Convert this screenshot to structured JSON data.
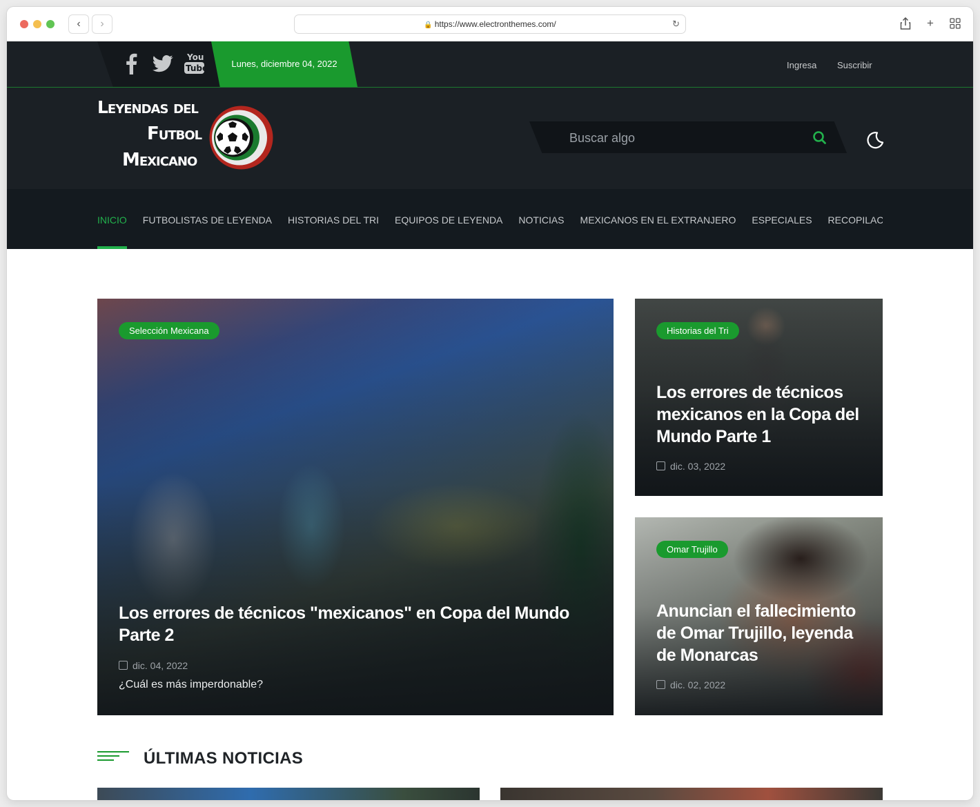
{
  "browser": {
    "url": "https://www.electronthemes.com/",
    "back_icon": "‹",
    "forward_icon": "›"
  },
  "topbar": {
    "date": "Lunes, diciembre 04, 2022",
    "links": [
      "Ingresa",
      "Suscribir"
    ],
    "social_icons": [
      "facebook-icon",
      "twitter-icon",
      "youtube-icon"
    ]
  },
  "header": {
    "logo_lines": [
      "Leyendas del",
      "Futbol",
      "Mexicano"
    ],
    "search_placeholder": "Buscar algo"
  },
  "nav": {
    "items": [
      "INICIO",
      "FUTBOLISTAS DE LEYENDA",
      "HISTORIAS DEL TRI",
      "EQUIPOS DE LEYENDA",
      "NOTICIAS",
      "MEXICANOS EN EL EXTRANJERO",
      "ESPECIALES",
      "RECOPILACIONES"
    ],
    "active": "INICIO"
  },
  "featured": {
    "main": {
      "tag": "Selección Mexicana",
      "title": "Los errores de técnicos \"mexicanos\" en Copa del Mundo Parte 2",
      "date": "dic. 04, 2022",
      "excerpt": "¿Cuál es más imperdonable?"
    },
    "side": [
      {
        "tag": "Historias del Tri",
        "title": "Los errores de técnicos mexicanos en la Copa del Mundo Parte 1",
        "date": "dic. 03, 2022"
      },
      {
        "tag": "Omar Trujillo",
        "title": "Anuncian el fallecimiento de Omar Trujillo, leyenda de Monarcas",
        "date": "dic. 02, 2022"
      }
    ]
  },
  "latest": {
    "title": "ÚLTIMAS NOTICIAS"
  },
  "colors": {
    "accent": "#1a9a2e",
    "dark": "#1b2025",
    "nav_bg": "#141a1f"
  }
}
